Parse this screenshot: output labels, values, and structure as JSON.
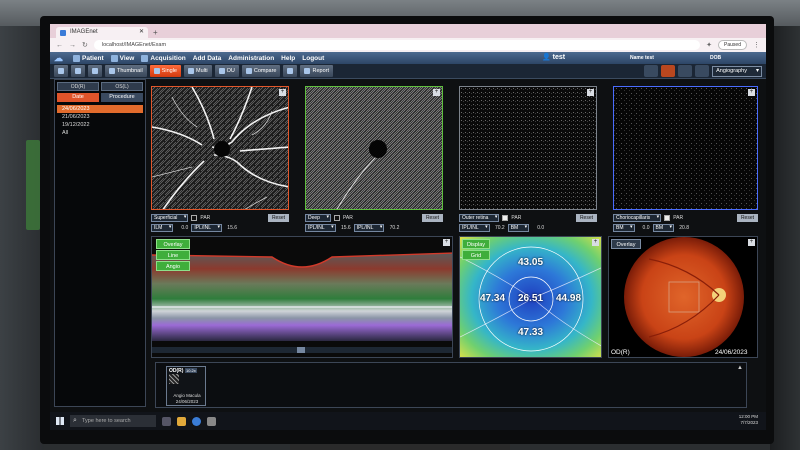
{
  "browser": {
    "tab_title": "IMAGEnet",
    "url": "localhost/IMAGEnet/Exam",
    "profile_status": "Paused"
  },
  "menu": {
    "items": [
      "Patient",
      "View",
      "Acquisition",
      "Add Data",
      "Administration",
      "Help",
      "Logout"
    ],
    "user": "test",
    "name_label": "Name",
    "name_value": "test",
    "dob_label": "DOB"
  },
  "toolbar": {
    "buttons": [
      "Thumbnail",
      "Single",
      "Multi",
      "OU",
      "Compare",
      "Report"
    ],
    "active": "Single",
    "mode_select": "Angiography"
  },
  "left_panel": {
    "eye_tabs": [
      "OD(R)",
      "OS(L)"
    ],
    "tabs": [
      "Date",
      "Procedure"
    ],
    "active_tab": "Date",
    "dates": [
      "24/06/2023",
      "21/06/2023",
      "19/12/2022",
      "All"
    ],
    "selected_date": "24/06/2023"
  },
  "angio_panels": [
    {
      "layer": "Superficial",
      "par_checked": false,
      "reset": "Reset",
      "from": "ILM",
      "from_offset": "0.0",
      "to": "IPL/INL",
      "to_offset": "15.6",
      "frame_color": "#e2572b"
    },
    {
      "layer": "Deep",
      "par_checked": false,
      "reset": "Reset",
      "from": "IPL/INL",
      "from_offset": "15.6",
      "to": "IPL/INL",
      "to_offset": "70.2",
      "frame_color": "#5fbf3f"
    },
    {
      "layer": "Outer retina",
      "par_checked": true,
      "reset": "Reset",
      "from": "IPL/INL",
      "from_offset": "70.2",
      "to": "BM",
      "to_offset": "0.0",
      "frame_color": "#7d848d"
    },
    {
      "layer": "Choriocapillaris",
      "par_checked": true,
      "reset": "Reset",
      "from": "BM",
      "from_offset": "0.0",
      "to": "BM",
      "to_offset": "20.8",
      "frame_color": "#4a6cff"
    }
  ],
  "labels": {
    "par": "PAR",
    "overlay": "Overlay",
    "line": "Line",
    "angio": "Angio",
    "display": "Display",
    "grid": "Grid"
  },
  "density": {
    "top": "43.05",
    "left": "47.34",
    "center": "26.51",
    "right": "44.98",
    "bottom": "47.33"
  },
  "fundus": {
    "eye": "OD(R)",
    "date": "24/06/2023"
  },
  "thumbnail": {
    "eye": "OD(R)",
    "size": "10.2x",
    "caption_line1": "Angio Macula",
    "caption_line2": "24/06/2023"
  },
  "taskbar": {
    "search_placeholder": "Type here to search",
    "clock_time": "12:00 PM",
    "clock_date": "7/7/2023"
  },
  "colors": {
    "accent_orange": "#e0542a",
    "overlay_green": "#3fae3b",
    "menu_blue": "#2d4566"
  }
}
